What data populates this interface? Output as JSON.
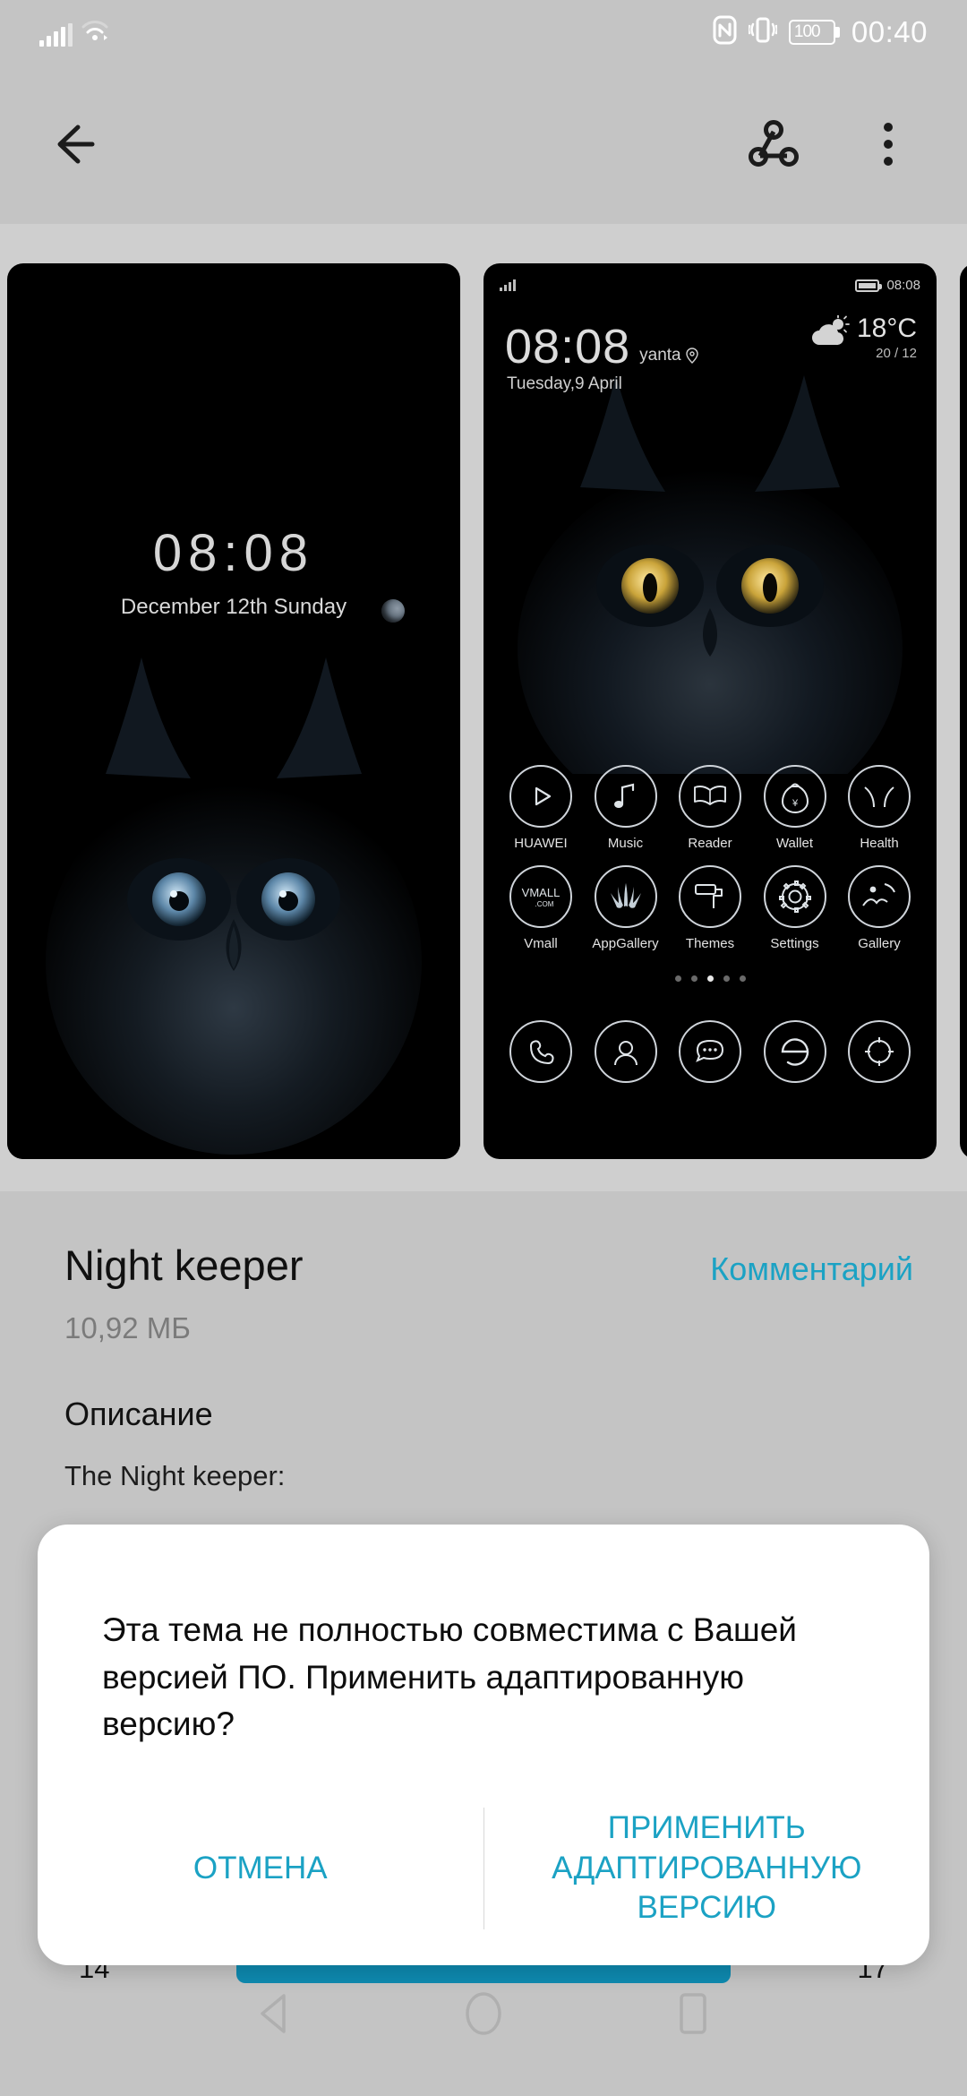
{
  "status_bar": {
    "signal_icon": "signal-bars-icon",
    "wifi_icon": "wifi-icon",
    "nfc_icon": "nfc-icon",
    "vibrate_icon": "vibrate-icon",
    "battery_level": "100",
    "time": "00:40"
  },
  "toolbar": {
    "back_icon": "arrow-left-icon",
    "share_icon": "share-nodes-icon",
    "more_icon": "overflow-menu-icon"
  },
  "previews": {
    "lock_screen": {
      "time": "08:08",
      "date": "December 12th  Sunday",
      "indicator_icon": "moon-dot-icon"
    },
    "home_screen": {
      "status_time": "08:08",
      "battery_icon": "battery-full-icon",
      "signal_icon": "signal-bars-icon",
      "clock": "08:08",
      "location": "yanta",
      "location_icon": "map-pin-icon",
      "date": "Tuesday,9 April",
      "weather_icon": "cloud-sun-icon",
      "temperature": "18°C",
      "temp_range": "20 / 12",
      "apps_row1": [
        {
          "label": "HUAWEI",
          "icon": "play-icon"
        },
        {
          "label": "Music",
          "icon": "music-note-icon"
        },
        {
          "label": "Reader",
          "icon": "open-book-icon"
        },
        {
          "label": "Wallet",
          "icon": "money-bag-icon"
        },
        {
          "label": "Health",
          "icon": "health-ball-icon"
        }
      ],
      "apps_row2": [
        {
          "label": "Vmall",
          "icon": "vmall-icon"
        },
        {
          "label": "AppGallery",
          "icon": "huawei-flower-icon"
        },
        {
          "label": "Themes",
          "icon": "paint-roller-icon"
        },
        {
          "label": "Settings",
          "icon": "gear-icon"
        },
        {
          "label": "Gallery",
          "icon": "photo-icon"
        }
      ],
      "dock": [
        {
          "label": "",
          "icon": "phone-icon"
        },
        {
          "label": "",
          "icon": "contacts-person-icon"
        },
        {
          "label": "",
          "icon": "message-bubble-icon"
        },
        {
          "label": "",
          "icon": "browser-e-icon"
        },
        {
          "label": "",
          "icon": "camera-shutter-icon"
        }
      ],
      "page_dots": 5,
      "page_dot_active": 2
    }
  },
  "info": {
    "title": "Night keeper",
    "comment_label": "Комментарий",
    "size": "10,92 МБ",
    "description_heading": "Описание",
    "description_text": "The Night keeper:"
  },
  "pager": {
    "left_number": "14",
    "right_number": "17"
  },
  "dialog": {
    "message": "Эта тема не полностью совместима с Вашей версией ПО. Применить адаптированную версию?",
    "cancel_label": "ОТМЕНА",
    "confirm_label": "ПРИМЕНИТЬ АДАПТИРОВАННУЮ ВЕРСИЮ"
  },
  "navbar": {
    "back_icon": "nav-back-triangle-icon",
    "home_icon": "nav-home-circle-icon",
    "recents_icon": "nav-recents-square-icon"
  },
  "colors": {
    "accent": "#1ba2c4",
    "progress": "#0e8ab0",
    "background": "#c4c4c4",
    "card_background": "#cfcfcf"
  }
}
